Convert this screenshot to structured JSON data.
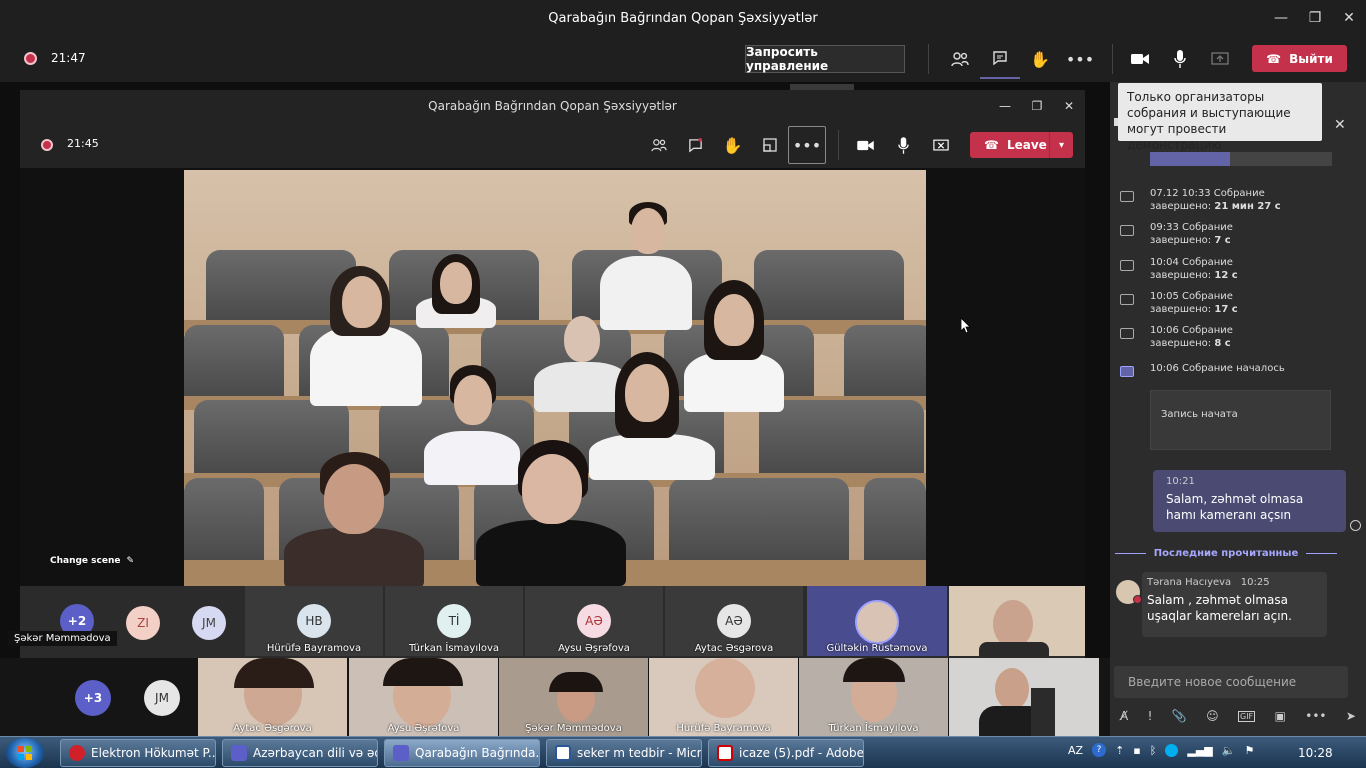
{
  "window": {
    "title": "Qarabağın Bağrından Qopan Şəxsiyyətlər"
  },
  "outer_toolbar": {
    "time": "21:47",
    "request_control": "Запросить управление",
    "leave": "Выйти"
  },
  "inner_window": {
    "title": "Qarabağın Bağrından Qopan Şəxsiyyətlər",
    "time": "21:45",
    "leave": "Leave"
  },
  "stage": {
    "change_scene": "Change scene",
    "presenter": "Şəkər Məmmədova"
  },
  "participants_row1": [
    {
      "initials": "+2",
      "name": "",
      "color": "#5b5fc7"
    },
    {
      "initials": "ZI",
      "name": "",
      "color": "#f2d0c6"
    },
    {
      "initials": "JM",
      "name": "",
      "color": "#d6d9f2"
    },
    {
      "initials": "HB",
      "name": "Hürüfə Bayramova",
      "color": "#d9e4ec"
    },
    {
      "initials": "Tİ",
      "name": "Türkan İsmayılova",
      "color": "#e0f0f0"
    },
    {
      "initials": "AƏ",
      "name": "Aysu Əşrəfova",
      "color": "#f6dbe3"
    },
    {
      "initials": "AƏ",
      "name": "Aytac Əsgərova",
      "color": "#e6e6e6"
    },
    {
      "initials": "",
      "name": "Gültəkin Rüstəmova",
      "color": ""
    },
    {
      "initials": "",
      "name": "",
      "color": ""
    }
  ],
  "participants_row2": {
    "overflow": "+3",
    "overflow_initials": "JM",
    "tiles": [
      "Aytac Əsgərova",
      "Aysu Əşrəfova",
      "Şəkər Məmmədova",
      "Hürüfə Bayramova",
      "Türkan İsmayılova",
      ""
    ]
  },
  "tooltip": "Только организаторы собрания и выступающие могут провести демонстрацию",
  "chat": {
    "events": [
      {
        "line1": "07.12 10:33   Собрание",
        "line2a": "завершено: ",
        "line2b": "21 мин 27 с"
      },
      {
        "line1": "09:33   Собрание",
        "line2a": "завершено: ",
        "line2b": "7 с"
      },
      {
        "line1": "10:04   Собрание",
        "line2a": "завершено: ",
        "line2b": "12 с"
      },
      {
        "line1": "10:05   Собрание",
        "line2a": "завершено: ",
        "line2b": "17 с"
      },
      {
        "line1": "10:06   Собрание",
        "line2a": "завершено: ",
        "line2b": "8 с"
      }
    ],
    "started": "10:06   Собрание началось",
    "recording": "Запись начата",
    "my_msg": {
      "time": "10:21",
      "text": "Salam, zəhmət olmasa hamı kameranı açsın"
    },
    "last_read": "Последние прочитанные",
    "other_msg": {
      "author": "Tərana Hacıyeva",
      "time": "10:25",
      "text": "Salam , zəhmət olmasa uşaqlar kamereları açın."
    },
    "compose_placeholder": "Введите новое сообщение"
  },
  "taskbar": {
    "items": [
      "Elektron Hökumət P...",
      "Azərbaycan dili və əd...",
      "Qarabağın Bağrında...",
      "seker m tedbir - Micr...",
      "icaze (5).pdf - Adobe..."
    ],
    "lang": "AZ",
    "clock": "10:28"
  },
  "colors": {
    "accent": "#6264a7",
    "leave": "#c4314b",
    "record": "#c4314b"
  }
}
